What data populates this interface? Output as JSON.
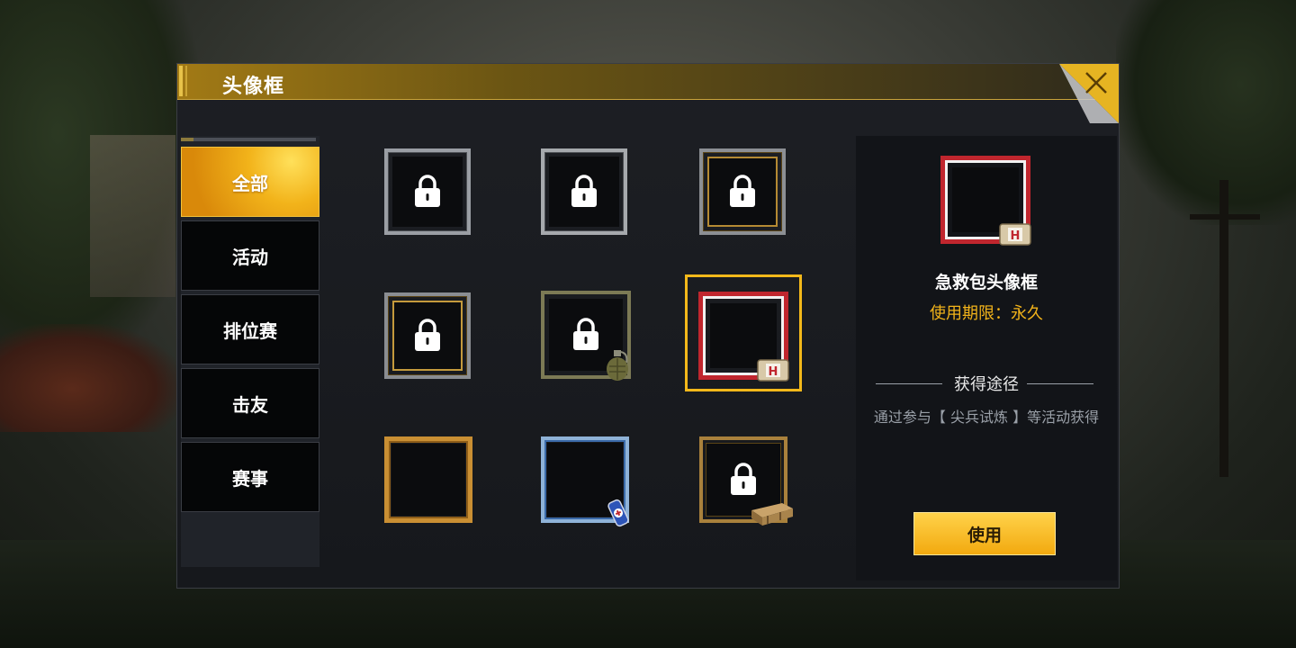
{
  "dialog": {
    "title": "头像框",
    "close_icon": "close-x-icon"
  },
  "sidebar": {
    "tabs": [
      {
        "label": "全部",
        "active": true
      },
      {
        "label": "活动",
        "active": false
      },
      {
        "label": "排位赛",
        "active": false
      },
      {
        "label": "击友",
        "active": false
      },
      {
        "label": "赛事",
        "active": false
      }
    ]
  },
  "grid": {
    "frames": [
      {
        "style": "silver",
        "locked": true
      },
      {
        "style": "silver-gold-corners",
        "locked": true
      },
      {
        "style": "gold",
        "locked": true
      },
      {
        "style": "gold-corners",
        "locked": true
      },
      {
        "style": "olive-grenade",
        "locked": true,
        "badge_icon": "grenade-icon"
      },
      {
        "style": "red-first-aid",
        "locked": false,
        "selected": true,
        "badge_icon": "first-aid-kit-icon"
      },
      {
        "style": "bronze",
        "locked": false
      },
      {
        "style": "blue-energy-drink",
        "locked": false,
        "badge_icon": "energy-drink-icon"
      },
      {
        "style": "crate",
        "locked": true,
        "badge_icon": "ammo-crate-icon"
      }
    ]
  },
  "detail": {
    "item_name": "急救包头像框",
    "duration": "使用期限：永久",
    "source_heading": "获得途径",
    "source_description": "通过参与【 尖兵试炼 】等活动获得",
    "use_button": "使用",
    "accent_color": "#f2b31a"
  }
}
